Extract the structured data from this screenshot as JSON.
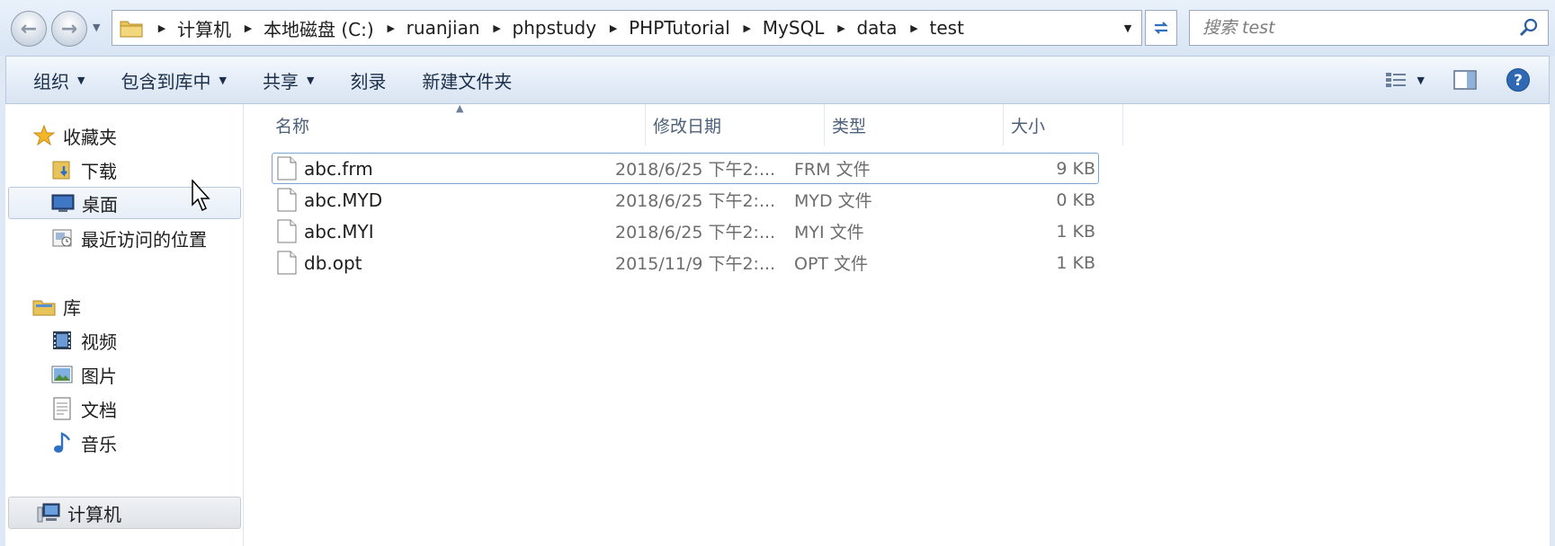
{
  "address": {
    "crumbs": [
      "计算机",
      "本地磁盘 (C:)",
      "ruanjian",
      "phpstudy",
      "PHPTutorial",
      "MySQL",
      "data",
      "test"
    ]
  },
  "search": {
    "placeholder": "搜索 test"
  },
  "toolbar": {
    "organize": "组织",
    "include_library": "包含到库中",
    "share": "共享",
    "burn": "刻录",
    "new_folder": "新建文件夹"
  },
  "nav": {
    "favorites": "收藏夹",
    "downloads": "下载",
    "desktop": "桌面",
    "recent": "最近访问的位置",
    "libraries": "库",
    "videos": "视频",
    "pictures": "图片",
    "documents": "文档",
    "music": "音乐",
    "computer": "计算机"
  },
  "columns": {
    "name": "名称",
    "date": "修改日期",
    "type": "类型",
    "size": "大小"
  },
  "files": [
    {
      "name": "abc.frm",
      "date": "2018/6/25 下午2:...",
      "type": "FRM 文件",
      "size": "9 KB"
    },
    {
      "name": "abc.MYD",
      "date": "2018/6/25 下午2:...",
      "type": "MYD 文件",
      "size": "0 KB"
    },
    {
      "name": "abc.MYI",
      "date": "2018/6/25 下午2:...",
      "type": "MYI 文件",
      "size": "1 KB"
    },
    {
      "name": "db.opt",
      "date": "2015/11/9 下午2:...",
      "type": "OPT 文件",
      "size": "1 KB"
    }
  ],
  "colors": {
    "accent": "#3a78c4",
    "selection_border": "#7aa3d6",
    "window_bg": "#dfe9f5"
  }
}
